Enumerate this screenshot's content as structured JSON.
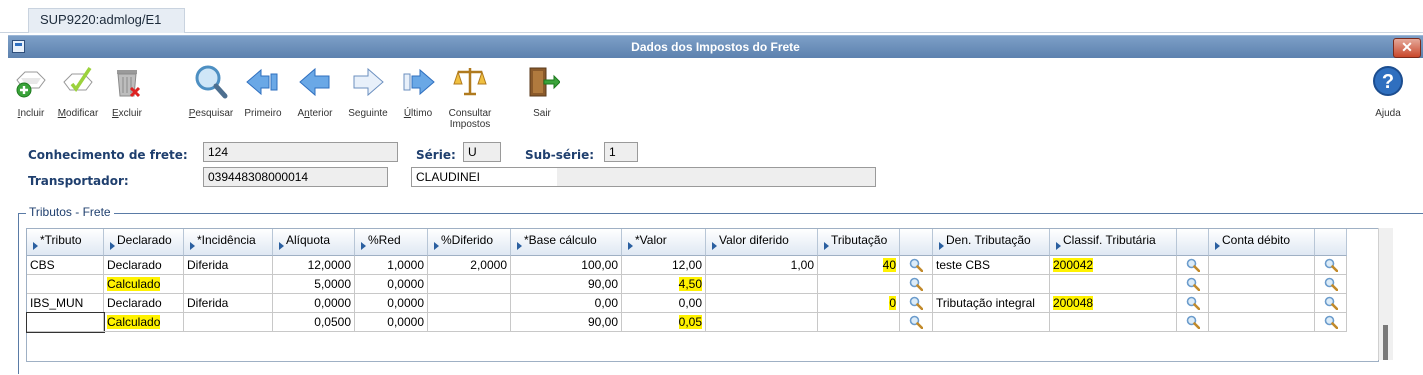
{
  "tab": {
    "label": "SUP9220:admlog/E1"
  },
  "window": {
    "title": "Dados dos Impostos do Frete",
    "close": "✕"
  },
  "toolbar": {
    "incluir": "Incluir",
    "modificar": "Modificar",
    "excluir": "Excluir",
    "pesquisar": "Pesquisar",
    "primeiro": "Primeiro",
    "anterior": "Anterior",
    "seguinte": "Seguinte",
    "ultimo": "Último",
    "consultar_1": "Consultar",
    "consultar_2": "Impostos",
    "sair": "Sair",
    "ajuda": "Ajuda"
  },
  "form": {
    "conhecimento_label": "Conhecimento de frete:",
    "conhecimento_value": "124",
    "serie_label": "Série:",
    "serie_value": "U",
    "subserie_label": "Sub-série:",
    "subserie_value": "1",
    "transportador_label": "Transportador:",
    "transportador_code": "039448308000014",
    "transportador_name": "CLAUDINEI"
  },
  "group": {
    "legend": "Tributos - Frete"
  },
  "grid": {
    "headers": [
      "*Tributo",
      "Declarado",
      "*Incidência",
      "Alíquota",
      "%Red",
      "%Diferido",
      "*Base cálculo",
      "*Valor",
      "Valor diferido",
      "Tributação",
      "",
      "Den. Tributação",
      "Classif. Tributária",
      "",
      "Conta débito",
      ""
    ],
    "rows": [
      [
        "CBS",
        "Declarado",
        "Diferida",
        "12,0000",
        "1,0000",
        "2,0000",
        "100,00",
        "12,00",
        "1,00",
        "40",
        "",
        "teste CBS",
        "200042",
        "",
        "",
        ""
      ],
      [
        "",
        "Calculado",
        "",
        "5,0000",
        "0,0000",
        "",
        "90,00",
        "4,50",
        "",
        "",
        "",
        "",
        "",
        "",
        "",
        ""
      ],
      [
        "IBS_MUN",
        "Declarado",
        "Diferida",
        "0,0000",
        "0,0000",
        "",
        "0,00",
        "0,00",
        "",
        "0",
        "",
        "Tributação integral",
        "200048",
        "",
        "",
        ""
      ],
      [
        "",
        "Calculado",
        "",
        "0,0500",
        "0,0000",
        "",
        "90,00",
        "0,05",
        "",
        "",
        "",
        "",
        "",
        "",
        "",
        ""
      ]
    ]
  },
  "colors": {
    "titlebar": "#5b80ad",
    "highlight": "#fff200",
    "label": "#1f3f6e"
  }
}
